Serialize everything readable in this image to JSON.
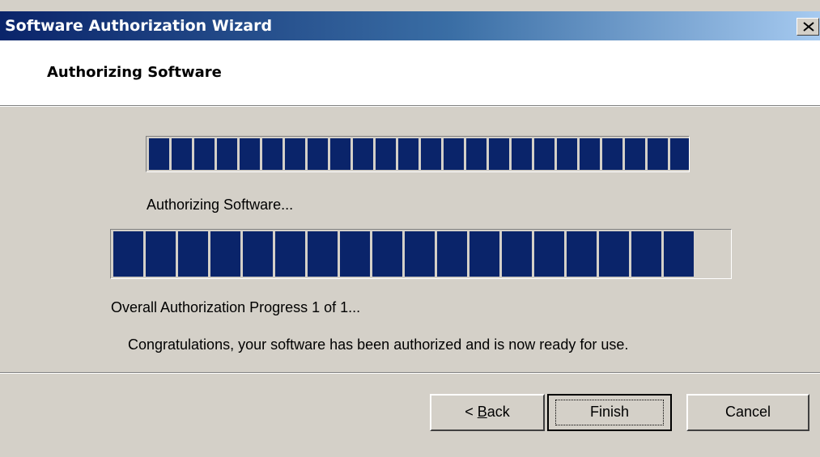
{
  "window": {
    "title": "Software Authorization Wizard"
  },
  "header": {
    "title": "Authorizing Software"
  },
  "progress": {
    "step": {
      "label": "Authorizing Software...",
      "value": 1.0,
      "blocks": 24
    },
    "overall": {
      "label": "Overall Authorization Progress 1 of 1...",
      "value": 1.0,
      "blocks": 18
    }
  },
  "message": "Congratulations, your software has been authorized and is now ready for use.",
  "buttons": {
    "back_prefix": "< ",
    "back_accel": "B",
    "back_rest": "ack",
    "finish": "Finish",
    "cancel": "Cancel"
  },
  "colors": {
    "accent": "#0a246a",
    "face": "#d4d0c8"
  }
}
